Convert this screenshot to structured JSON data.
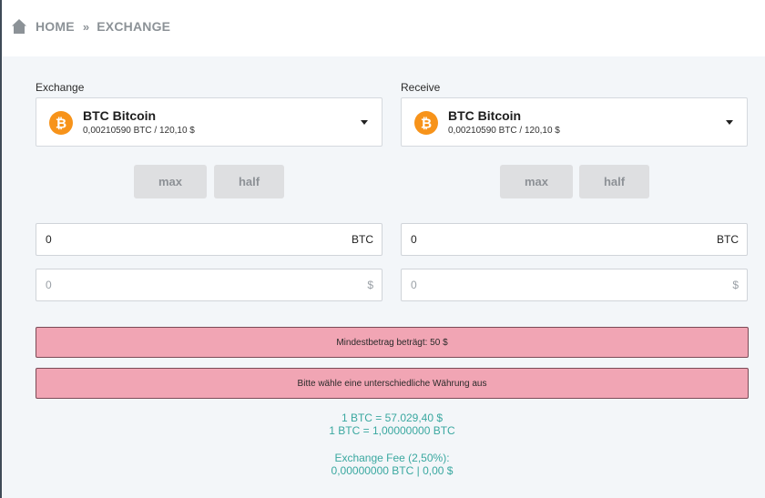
{
  "breadcrumb": {
    "home": "HOME",
    "separator": "»",
    "current": "EXCHANGE"
  },
  "exchange": {
    "label": "Exchange",
    "coin_name": "BTC Bitcoin",
    "coin_balance": "0,00210590 BTC / 120,10 $",
    "icon": "bitcoin-icon",
    "max_label": "max",
    "half_label": "half",
    "amount_value": "0",
    "amount_unit": "BTC",
    "fiat_value": "0",
    "fiat_unit": "$"
  },
  "receive": {
    "label": "Receive",
    "coin_name": "BTC Bitcoin",
    "coin_balance": "0,00210590 BTC / 120,10 $",
    "icon": "bitcoin-icon",
    "max_label": "max",
    "half_label": "half",
    "amount_value": "0",
    "amount_unit": "BTC",
    "fiat_value": "0",
    "fiat_unit": "$"
  },
  "alerts": {
    "min_amount": "Mindestbetrag beträgt: 50 $",
    "different_currency": "Bitte wähle eine unterschiedliche Währung aus"
  },
  "rates": {
    "line1": "1 BTC = 57.029,40 $",
    "line2": "1 BTC = 1,00000000 BTC"
  },
  "fee": {
    "label": "Exchange Fee (2,50%):",
    "value": "0,00000000 BTC | 0,00 $"
  },
  "colors": {
    "bitcoin_orange": "#f7931a",
    "alert_bg": "#f1a5b4",
    "info_teal": "#3aa8a0"
  }
}
